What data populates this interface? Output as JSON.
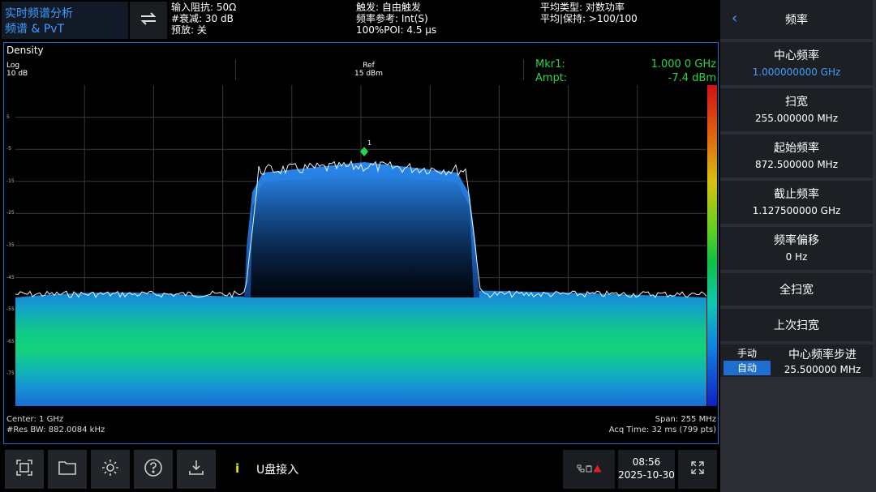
{
  "mode": {
    "line1": "实时频谱分析",
    "line2": "频谱 & PvT"
  },
  "header": {
    "col1": [
      "输入阻抗: 50Ω",
      "#衰减: 30 dB",
      "预放: 关"
    ],
    "col2": [
      "触发: 自由触发",
      "频率参考: Int(S)",
      "100%POI: 4.5 μs"
    ],
    "col3": [
      "平均类型: 对数功率",
      "平均|保持: >100/100"
    ]
  },
  "plot": {
    "title": "Density",
    "scale_line1": "Log",
    "scale_line2": "10 dB",
    "ref_line1": "Ref",
    "ref_line2": "15 dBm",
    "marker_label": "Mkr1:",
    "marker_freq": "1.000 0 GHz",
    "ampt_label": "Ampt:",
    "marker_ampt": "-7.4 dBm",
    "marker_number": "1",
    "y_ticks": [
      "5",
      "-5",
      "-15",
      "-25",
      "-35",
      "-45",
      "-55",
      "-65",
      "-75"
    ],
    "center": "Center: 1 GHz",
    "res_bw": "#Res BW: 882.0084 kHz",
    "span": "Span: 255 MHz",
    "acq_time": "Acq Time: 32 ms (799 pts)"
  },
  "bottom": {
    "usb_message": "U盘接入",
    "info_icon": "i",
    "status_icons": "network-icon, usb-icon, warning-icon",
    "time": "08:56",
    "date": "2025-10-30"
  },
  "menu": {
    "title": "频率",
    "items": [
      {
        "label": "中心频率",
        "value": "1.000000000 GHz",
        "active": true
      },
      {
        "label": "扫宽",
        "value": "255.000000 MHz"
      },
      {
        "label": "起始频率",
        "value": "872.500000 MHz"
      },
      {
        "label": "截止频率",
        "value": "1.127500000 GHz"
      },
      {
        "label": "频率偏移",
        "value": "0 Hz"
      }
    ],
    "full_span": "全扫宽",
    "last_span": "上次扫宽",
    "step": {
      "manual": "手动",
      "auto": "自动",
      "label": "中心频率步进",
      "value": "25.500000 MHz"
    }
  },
  "colors": {
    "accent": "#3f9cff",
    "marker": "#2bd34a",
    "frame": "#1e6fd6"
  }
}
